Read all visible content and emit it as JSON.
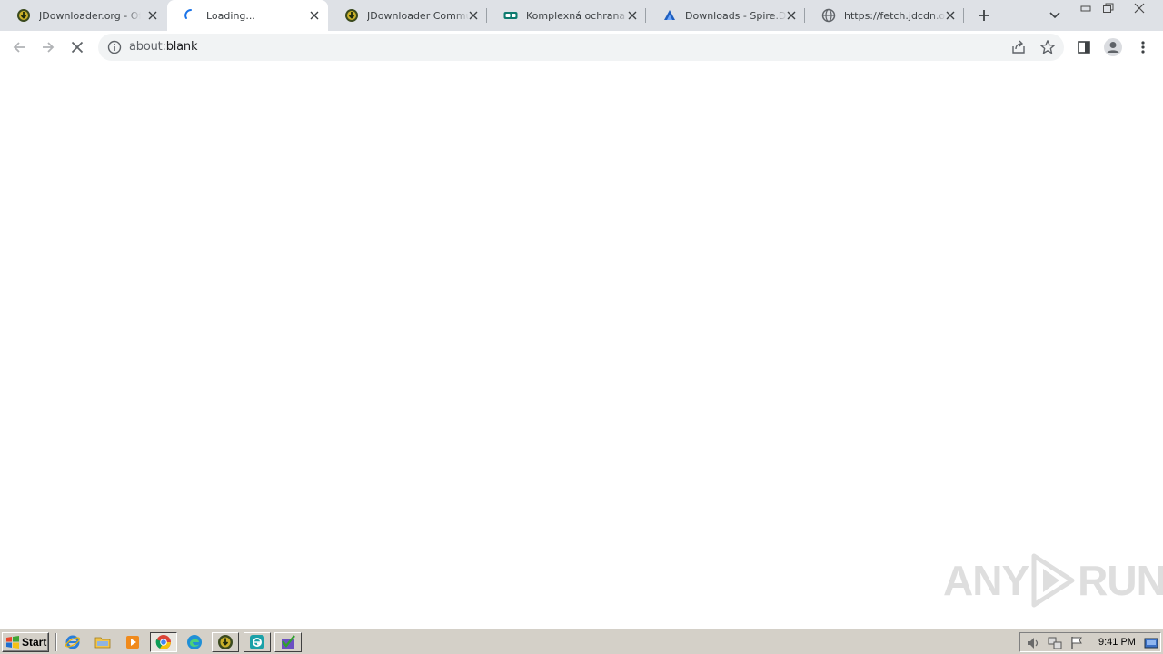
{
  "browser": {
    "tabs": [
      {
        "title": "JDownloader.org - Official Homepage",
        "favicon": "jdownloader-icon",
        "active": false
      },
      {
        "title": "Loading...",
        "favicon": "loading-spinner-icon",
        "active": true
      },
      {
        "title": "JDownloader Community",
        "favicon": "jdownloader-icon",
        "active": false
      },
      {
        "title": "Komplexná ochrana vášho",
        "favicon": "eset-icon",
        "active": false
      },
      {
        "title": "Downloads - Spire.Doc",
        "favicon": "spire-icon",
        "active": false
      },
      {
        "title": "https://fetch.jdcdn.org",
        "favicon": "globe-icon",
        "active": false
      }
    ],
    "address_bar": {
      "scheme": "about:",
      "host": "blank"
    }
  },
  "watermark": {
    "text_left": "ANY",
    "text_right": "RUN"
  },
  "taskbar": {
    "start_label": "Start",
    "clock": "9:41 PM"
  },
  "colors": {
    "tabstrip_bg": "#dee1e6",
    "omnibox_bg": "#f1f3f4",
    "taskbar_bg": "#d4d0c8"
  }
}
